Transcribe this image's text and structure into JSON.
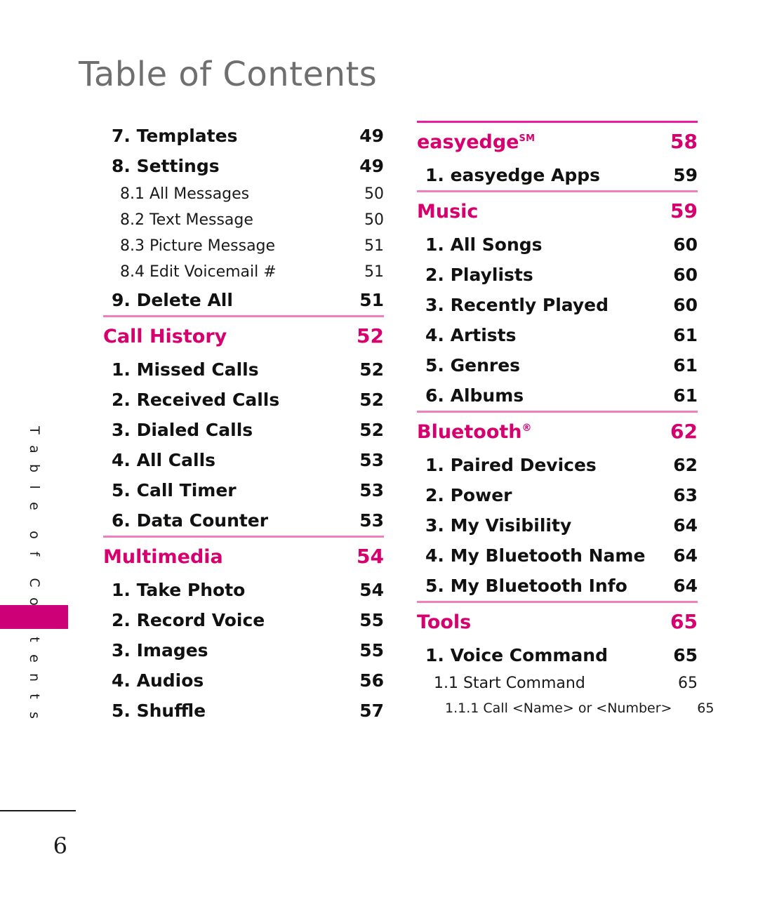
{
  "page": {
    "title": "Table of Contents",
    "side_tab_label": "Table of Contents",
    "page_number": "6",
    "accent_heading_color": "#D6006E",
    "accent_tab_color": "#CE0077",
    "rule_color": "#F07FC0",
    "rule_color_strong": "#ED1C9B",
    "title_color": "#6F6F6F",
    "body_text_color": "#111111"
  },
  "columns": [
    {
      "name": "left-column",
      "blocks": [
        {
          "type": "entries",
          "rule": "none",
          "items": [
            {
              "level": 1,
              "label": "7. Templates",
              "page": "49"
            },
            {
              "level": 1,
              "label": "8. Settings",
              "page": "49"
            },
            {
              "level": 2,
              "label": "8.1 All Messages",
              "page": "50"
            },
            {
              "level": 2,
              "label": "8.2 Text Message",
              "page": "50"
            },
            {
              "level": 2,
              "label": "8.3 Picture Message",
              "page": "51"
            },
            {
              "level": 2,
              "label": "8.4 Edit Voicemail #",
              "page": "51"
            },
            {
              "level": 1,
              "label": "9. Delete All",
              "page": "51"
            }
          ]
        },
        {
          "type": "section",
          "rule": "light",
          "heading": {
            "label": "Call History",
            "page": "52"
          },
          "items": [
            {
              "level": 1,
              "label": "1. Missed Calls",
              "page": "52"
            },
            {
              "level": 1,
              "label": "2. Received Calls",
              "page": "52"
            },
            {
              "level": 1,
              "label": "3. Dialed Calls",
              "page": "52"
            },
            {
              "level": 1,
              "label": "4. All Calls",
              "page": "53"
            },
            {
              "level": 1,
              "label": "5. Call Timer",
              "page": "53"
            },
            {
              "level": 1,
              "label": "6. Data Counter",
              "page": "53"
            }
          ]
        },
        {
          "type": "section",
          "rule": "light",
          "heading": {
            "label": "Multimedia",
            "page": "54"
          },
          "items": [
            {
              "level": 1,
              "label": "1. Take Photo",
              "page": "54"
            },
            {
              "level": 1,
              "label": "2. Record Voice",
              "page": "55"
            },
            {
              "level": 1,
              "label": "3. Images",
              "page": "55"
            },
            {
              "level": 1,
              "label": "4. Audios",
              "page": "56"
            },
            {
              "level": 1,
              "label": "5. Shuffle",
              "page": "57"
            }
          ]
        }
      ]
    },
    {
      "name": "right-column",
      "blocks": [
        {
          "type": "section",
          "rule": "strong",
          "heading": {
            "label": "easyedge",
            "superscript": "SM",
            "page": "58"
          },
          "items": [
            {
              "level": 1,
              "label": "1. easyedge Apps",
              "page": "59"
            }
          ]
        },
        {
          "type": "section",
          "rule": "light",
          "heading": {
            "label": "Music",
            "page": "59"
          },
          "items": [
            {
              "level": 1,
              "label": "1. All Songs",
              "page": "60"
            },
            {
              "level": 1,
              "label": "2. Playlists",
              "page": "60"
            },
            {
              "level": 1,
              "label": "3. Recently Played",
              "page": "60"
            },
            {
              "level": 1,
              "label": "4. Artists",
              "page": "61"
            },
            {
              "level": 1,
              "label": "5. Genres",
              "page": "61"
            },
            {
              "level": 1,
              "label": "6. Albums",
              "page": "61"
            }
          ]
        },
        {
          "type": "section",
          "rule": "light",
          "heading": {
            "label": "Bluetooth",
            "superscript": "®",
            "page": "62"
          },
          "items": [
            {
              "level": 1,
              "label": "1. Paired Devices",
              "page": "62"
            },
            {
              "level": 1,
              "label": "2. Power",
              "page": "63"
            },
            {
              "level": 1,
              "label": "3. My Visibility",
              "page": "64"
            },
            {
              "level": 1,
              "label": "4. My Bluetooth Name",
              "page": "64"
            },
            {
              "level": 1,
              "label": "5. My Bluetooth Info",
              "page": "64"
            }
          ]
        },
        {
          "type": "section",
          "rule": "light",
          "heading": {
            "label": "Tools",
            "page": "65"
          },
          "items": [
            {
              "level": 1,
              "label": "1. Voice Command",
              "page": "65"
            },
            {
              "level": 2,
              "label": "1.1 Start Command",
              "page": "65"
            },
            {
              "level": 3,
              "label": "1.1.1  Call <Name> or <Number>",
              "page": "65"
            }
          ]
        }
      ]
    }
  ]
}
